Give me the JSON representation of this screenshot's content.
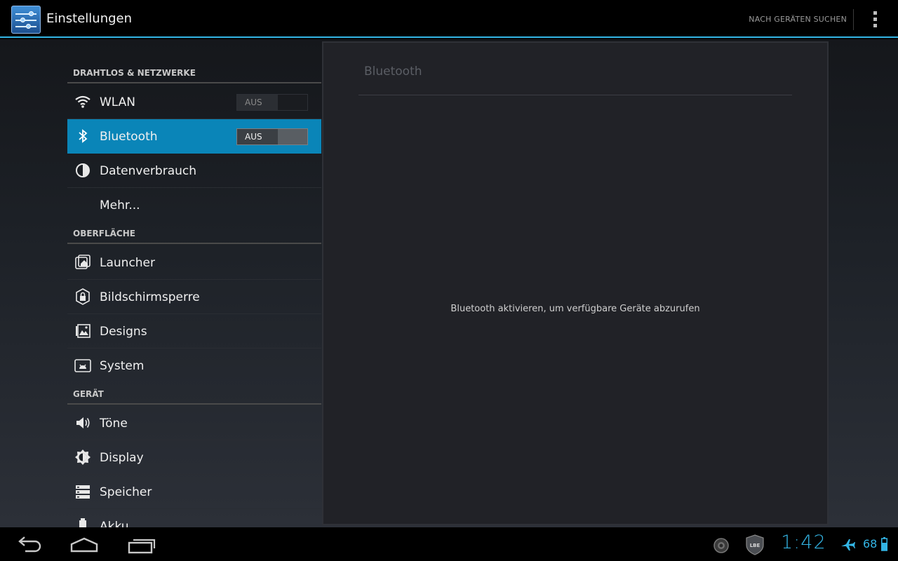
{
  "action_bar": {
    "title": "Einstellungen",
    "action_label": "NACH GERÄTEN SUCHEN"
  },
  "settings_list": {
    "sections": [
      {
        "header": "DRAHTLOS & NETZWERKE",
        "items": [
          {
            "label": "WLAN",
            "icon": "wifi-icon",
            "toggle": "AUS"
          },
          {
            "label": "Bluetooth",
            "icon": "bluetooth-icon",
            "toggle": "AUS",
            "selected": true
          },
          {
            "label": "Datenverbrauch",
            "icon": "data-usage-icon"
          },
          {
            "label": "Mehr..."
          }
        ]
      },
      {
        "header": "OBERFLÄCHE",
        "items": [
          {
            "label": "Launcher",
            "icon": "launcher-icon"
          },
          {
            "label": "Bildschirmsperre",
            "icon": "lock-screen-icon"
          },
          {
            "label": "Designs",
            "icon": "themes-icon"
          },
          {
            "label": "System",
            "icon": "system-icon"
          }
        ]
      },
      {
        "header": "GERÄT",
        "items": [
          {
            "label": "Töne",
            "icon": "sound-icon"
          },
          {
            "label": "Display",
            "icon": "display-icon"
          },
          {
            "label": "Speicher",
            "icon": "storage-icon"
          },
          {
            "label": "Akku",
            "icon": "battery-icon"
          }
        ]
      }
    ]
  },
  "detail": {
    "title": "Bluetooth",
    "message": "Bluetooth aktivieren, um verfügbare Geräte abzurufen"
  },
  "status_bar": {
    "time": "1:42",
    "battery": "68",
    "icons": [
      "back-icon",
      "home-icon",
      "recent-apps-icon",
      "notification-icon",
      "lbe-shield-icon",
      "airplane-mode-icon",
      "battery-icon"
    ],
    "shield_text": "LBE"
  },
  "colors": {
    "accent": "#33b5e5",
    "selected_item": "#0a85b8"
  }
}
